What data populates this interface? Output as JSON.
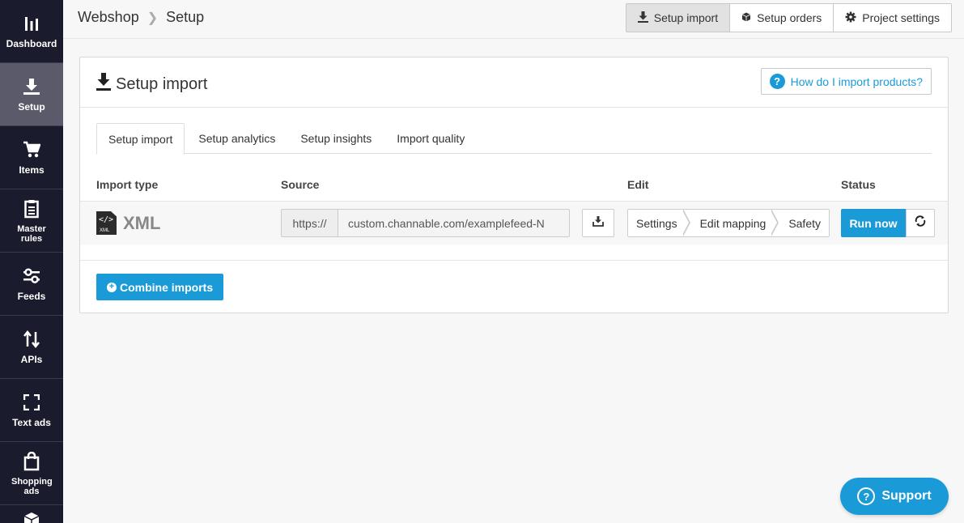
{
  "sidebar": {
    "items": [
      {
        "label": "Dashboard",
        "icon": "bar-chart-icon"
      },
      {
        "label": "Setup",
        "icon": "download-icon",
        "active": true
      },
      {
        "label": "Items",
        "icon": "cart-icon"
      },
      {
        "label": "Master rules",
        "icon": "clipboard-icon"
      },
      {
        "label": "Feeds",
        "icon": "sliders-icon"
      },
      {
        "label": "APIs",
        "icon": "arrows-icon"
      },
      {
        "label": "Text ads",
        "icon": "frame-icon"
      },
      {
        "label": "Shopping ads",
        "icon": "bag-icon"
      },
      {
        "label": "",
        "icon": "box-icon"
      }
    ]
  },
  "breadcrumb": {
    "project": "Webshop",
    "page": "Setup"
  },
  "top_actions": {
    "setup_import": "Setup import",
    "setup_orders": "Setup orders",
    "project_settings": "Project settings"
  },
  "panel": {
    "title": "Setup import",
    "help_link": "How do I import products?",
    "help_glyph": "?"
  },
  "tabs": [
    "Setup import",
    "Setup analytics",
    "Setup insights",
    "Import quality"
  ],
  "table": {
    "headers": {
      "import_type": "Import type",
      "source": "Source",
      "edit": "Edit",
      "status": "Status"
    },
    "row": {
      "type": "XML",
      "file_icon_code": "</>",
      "file_icon_ext": "XML",
      "source_prefix": "https://",
      "source_value": "custom.channable.com/examplefeed-N",
      "edit_steps": [
        "Settings",
        "Edit mapping",
        "Safety"
      ],
      "run_label": "Run now"
    }
  },
  "combine_button": "Combine imports",
  "support": {
    "label": "Support",
    "glyph": "?"
  },
  "colors": {
    "accent": "#1a9bd7",
    "sidebar_bg": "#1b1b2e",
    "sidebar_active": "#5a5a6a"
  }
}
